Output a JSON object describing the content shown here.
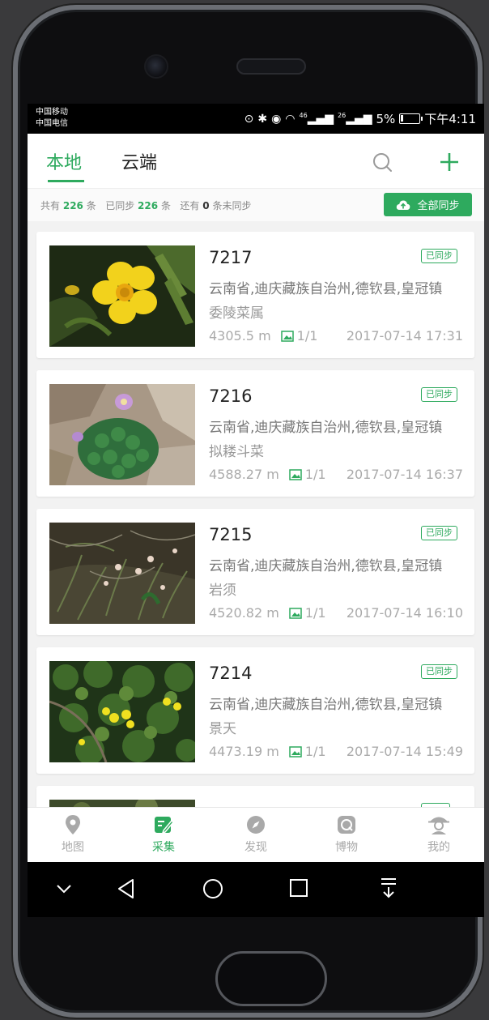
{
  "status_bar": {
    "carrier_1": "中国移动",
    "carrier_2": "中国电信",
    "network_1": "46",
    "network_2": "26",
    "battery": "5%",
    "time": "下午4:11"
  },
  "tabs": {
    "local": "本地",
    "cloud": "云端"
  },
  "summary": {
    "total_prefix": "共有",
    "total_count": "226",
    "total_suffix": "条",
    "synced_prefix": "已同步",
    "synced_count": "226",
    "synced_suffix": "条",
    "unsynced_prefix": "还有",
    "unsynced_count": "0",
    "unsynced_suffix": "条未同步",
    "sync_all_label": "全部同步"
  },
  "records": [
    {
      "id": "7217",
      "status": "已同步",
      "location": "云南省,迪庆藏族自治州,德钦县,皇冠镇",
      "species": "委陵菜属",
      "altitude": "4305.5 m",
      "images": "1/1",
      "datetime": "2017-07-14 17:31"
    },
    {
      "id": "7216",
      "status": "已同步",
      "location": "云南省,迪庆藏族自治州,德钦县,皇冠镇",
      "species": "拟耧斗菜",
      "altitude": "4588.27 m",
      "images": "1/1",
      "datetime": "2017-07-14 16:37"
    },
    {
      "id": "7215",
      "status": "已同步",
      "location": "云南省,迪庆藏族自治州,德钦县,皇冠镇",
      "species": "岩须",
      "altitude": "4520.82 m",
      "images": "1/1",
      "datetime": "2017-07-14 16:10"
    },
    {
      "id": "7214",
      "status": "已同步",
      "location": "云南省,迪庆藏族自治州,德钦县,皇冠镇",
      "species": "景天",
      "altitude": "4473.19 m",
      "images": "1/1",
      "datetime": "2017-07-14 15:49"
    }
  ],
  "bottom_nav": [
    {
      "label": "地图",
      "icon": "map-pin-icon"
    },
    {
      "label": "采集",
      "icon": "edit-icon",
      "active": true
    },
    {
      "label": "发现",
      "icon": "compass-icon"
    },
    {
      "label": "博物",
      "icon": "museum-icon"
    },
    {
      "label": "我的",
      "icon": "profile-icon"
    }
  ],
  "colors": {
    "accent": "#2eaa5e",
    "text_gray": "#8a8a8a"
  }
}
